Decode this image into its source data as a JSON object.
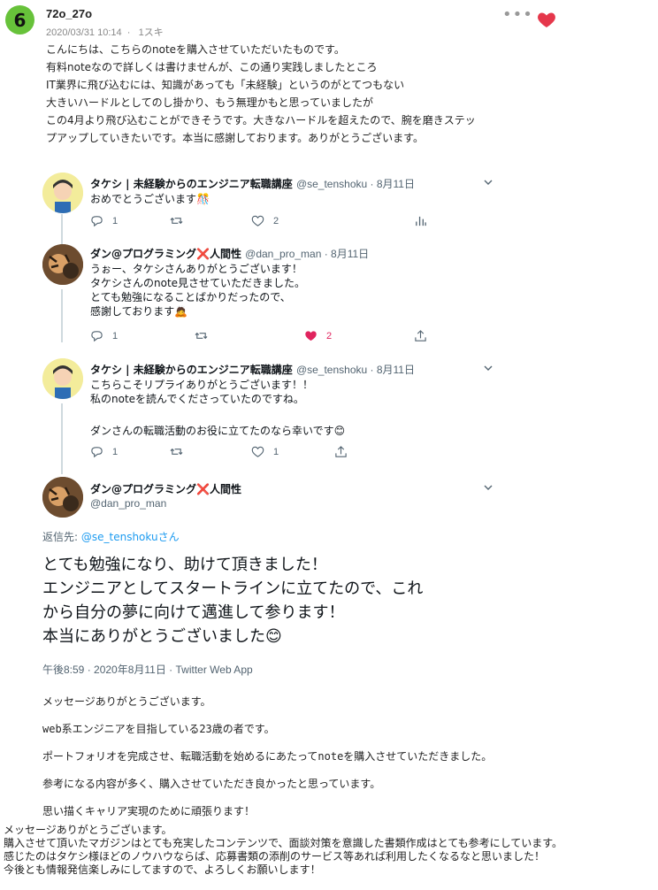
{
  "comment": {
    "badge": "6",
    "username": "72o_27o",
    "date": "2020/03/31 10:14",
    "separator": "·",
    "likes": "1スキ",
    "body_lines": [
      "こんにちは、こちらのnoteを購入させていただいたものです。",
      "有料noteなので詳しくは書けませんが、この通り実践しましたところ",
      "IT業界に飛び込むには、知識があっても「未経験」というのがとてつもない",
      "大きいハードルとしてのし掛かり、もう無理かもと思っていましたが",
      "この4月より飛び込むことができそうです。大きなハードルを超えたので、腕を磨きステッ",
      "プアップしていきたいです。本当に感謝しております。ありがとうございます。"
    ]
  },
  "thread": [
    {
      "name": "タケシ | 未経験からのエンジニア転職講座",
      "handle": "@se_tenshoku · 8月11日",
      "lines": [
        "おめでとうございます🎊"
      ],
      "replies": "1",
      "retweets": "",
      "likes": "2",
      "liked": false
    },
    {
      "name": "ダン@プログラミング❌人間性",
      "handle": "@dan_pro_man · 8月11日",
      "lines": [
        "うぉー、タケシさんありがとうございます！",
        "タケシさんのnote見させていただきました。",
        "とても勉強になることばかりだったので、",
        "感謝しております🙇"
      ],
      "replies": "1",
      "retweets": "",
      "likes": "2",
      "liked": true
    },
    {
      "name": "タケシ | 未経験からのエンジニア転職講座",
      "handle": "@se_tenshoku · 8月11日",
      "lines": [
        "こちらこそリプライありがとうございます！！",
        "私のnoteを読んでくださっていたのですね。",
        "",
        "ダンさんの転職活動のお役に立てたのなら幸いです😊"
      ],
      "replies": "1",
      "retweets": "",
      "likes": "1",
      "liked": false
    }
  ],
  "main_tweet": {
    "name": "ダン@プログラミング❌人間性",
    "handle": "@dan_pro_man",
    "reply_prefix": "返信先: ",
    "reply_mention": "@se_tenshokuさん",
    "lines": [
      "とても勉強になり、助けて頂きました！",
      "エンジニアとしてスタートラインに立てたので、これ",
      "から自分の夢に向けて邁進して参ります！",
      "本当にありがとうございました😊"
    ],
    "meta": "午後8:59 · 2020年8月11日 · Twitter Web App"
  },
  "message_lines": [
    "メッセージありがとうございます。",
    "web系エンジニアを目指している23歳の者です。",
    "ポートフォリオを完成させ、転職活動を始めるにあたってnoteを購入させていただきました。",
    "参考になる内容が多く、購入させていただき良かったと思っています。",
    "思い描くキャリア実現のために頑張ります！"
  ],
  "reply_lines": [
    "メッセージありがとうございます。",
    "購入させて頂いたマガジンはとても充実したコンテンツで、面談対策を意識した書類作成はとても参考にしています。",
    "感じたのはタケシ様ほどのノウハウならば、応募書類の添削のサービス等あれば利用したくなるなと思いました！",
    "今後とも情報発信楽しみにしてますので、よろしくお願いします！"
  ]
}
